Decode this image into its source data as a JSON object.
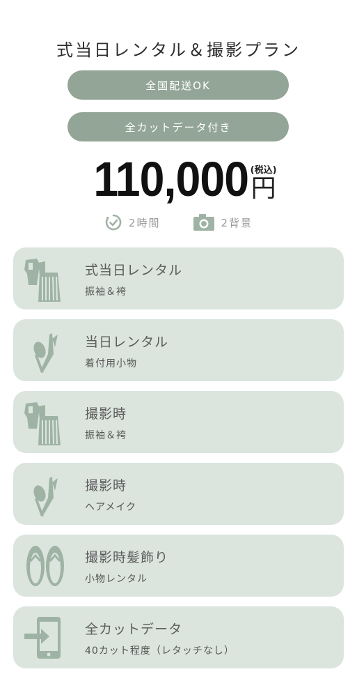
{
  "header": {
    "title": "式当日レンタル＆撮影プラン",
    "badges": [
      "全国配送OK",
      "全カットデータ付き"
    ]
  },
  "price": {
    "amount": "110,000",
    "tax_label": "(税込)",
    "currency": "円"
  },
  "meta": {
    "duration": "2時間",
    "backgrounds": "2背景"
  },
  "colors": {
    "badge_bg": "#93a596",
    "card_bg": "#dbe5de",
    "icon": "#9fb3a5"
  },
  "items": [
    {
      "title": "式当日レンタル",
      "subtitle": "振袖＆袴",
      "icon": "kimono-hakama-icon"
    },
    {
      "title": "当日レンタル",
      "subtitle": "着付用小物",
      "icon": "accessories-icon"
    },
    {
      "title": "撮影時",
      "subtitle": "振袖＆袴",
      "icon": "kimono-hakama-icon"
    },
    {
      "title": "撮影時",
      "subtitle": "ヘアメイク",
      "icon": "makeup-brush-icon"
    },
    {
      "title": "撮影時髪飾り",
      "subtitle": "小物レンタル",
      "icon": "zori-sandals-icon"
    },
    {
      "title": "全カットデータ",
      "subtitle": "40カット程度（レタッチなし）",
      "icon": "data-transfer-icon"
    }
  ]
}
